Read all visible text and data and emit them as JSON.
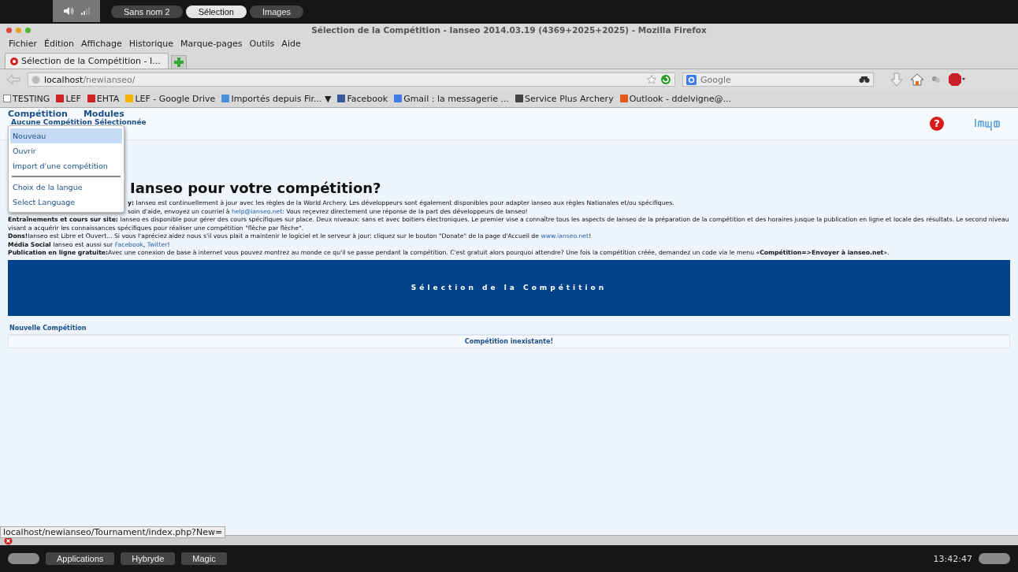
{
  "top_panel": {
    "tabs": [
      {
        "label": "Sans nom 2",
        "selected": false
      },
      {
        "label": "Sélection",
        "selected": true
      },
      {
        "label": "Images",
        "selected": false
      }
    ]
  },
  "window": {
    "title": "Sélection de la Compétition - Ianseo 2014.03.19 (4369+2025+2025) - Mozilla Firefox",
    "menu": [
      "Fichier",
      "Édition",
      "Affichage",
      "Historique",
      "Marque-pages",
      "Outils",
      "Aide"
    ],
    "tab_title": "Sélection de la Compétition - I...",
    "url": {
      "host": "localhost",
      "path": "/newianseo/"
    },
    "search": {
      "placeholder": "Google"
    },
    "bookmarks": [
      {
        "label": "TESTING",
        "kind": "blank"
      },
      {
        "label": "LEF",
        "kind": "ianseo"
      },
      {
        "label": "EHTA",
        "kind": "ianseo"
      },
      {
        "label": "LEF - Google Drive",
        "kind": "drive"
      },
      {
        "label": "Importés depuis Fir... ▼",
        "kind": "folder"
      },
      {
        "label": "Facebook",
        "kind": "facebook"
      },
      {
        "label": "Gmail : la messagerie ...",
        "kind": "google"
      },
      {
        "label": "Service Plus Archery",
        "kind": "service"
      },
      {
        "label": "Outlook - ddelvigne@...",
        "kind": "outlook"
      }
    ]
  },
  "page": {
    "nav": [
      "Compétition",
      "Modules"
    ],
    "subtitle": "Aucune Compétition Sélectionnée",
    "dropdown": [
      [
        {
          "label": "Nouveau",
          "selected": true
        },
        {
          "label": "Ouvrir",
          "selected": false
        },
        {
          "label": "Import d'une compétition",
          "selected": false
        }
      ],
      [
        {
          "label": "Choix de la langue",
          "selected": false
        },
        {
          "label": "Select Language",
          "selected": false
        }
      ]
    ],
    "help_icon": "?",
    "heading": "Ianseo pour votre compétition?",
    "paragraphs": [
      [
        {
          "kind": "bold",
          "text": "y:"
        },
        {
          "kind": "plain",
          "text": " Ianseo est continuellement à jour avec les règles de la World Archery. Les développeurs sont également disponibles pour adapter ianseo aux règles Nationales et/ou spécifiques."
        }
      ],
      [
        {
          "kind": "plain",
          "text": "soin d'aide, envoyez un courriel à "
        },
        {
          "kind": "link",
          "text": "help@ianseo.net"
        },
        {
          "kind": "plain",
          "text": ": Vous reçevrez directement une réponse de la part des développeurs de Ianseo!"
        }
      ],
      [
        {
          "kind": "bold",
          "text": "Entraînements et cours sur site:"
        },
        {
          "kind": "plain",
          "text": " Ianseo es disponible pour gérer des cours spécifiques sur place. Deux niveaux: sans et avec boitiers électroniques. Le premier vise a connaître tous les aspects de Ianseo de la préparation de la compétition et des horaires jusque la publication en ligne et locale des résultats. Le second niveau visant a acquérir les connaissances spécifiques pour réaliser une compétition \"flèche par flèche\"."
        }
      ],
      [
        {
          "kind": "bold",
          "text": "Dons!"
        },
        {
          "kind": "plain",
          "text": "Ianseo est Libre et Ouvert... Si vous l'apréciez aidez nous s'il vous plait a maintenir le logiciel et le serveur à jour: cliquez sur le bouton \"Donate\" de la page d'Accueil de "
        },
        {
          "kind": "link",
          "text": "www.ianseo.net"
        },
        {
          "kind": "plain",
          "text": "!"
        }
      ],
      [
        {
          "kind": "bold",
          "text": "Média Social"
        },
        {
          "kind": "plain",
          "text": " Ianseo est aussi sur "
        },
        {
          "kind": "link",
          "text": "Facebook"
        },
        {
          "kind": "plain",
          "text": ", "
        },
        {
          "kind": "link",
          "text": "Twitter"
        },
        {
          "kind": "plain",
          "text": "!"
        }
      ],
      [
        {
          "kind": "bold",
          "text": "Publication en ligne gratuite:"
        },
        {
          "kind": "plain",
          "text": "Avec une conexion de base à internet vous pouvez montrez au monde ce qu'il se passe pendant la compétition. C'est gratuit alors pourquoi attendre? Une fois la compétition créée, demandez un code via le menu «"
        },
        {
          "kind": "bold",
          "text": "Compétition=>Envoyer à ianseo.net"
        },
        {
          "kind": "plain",
          "text": "»."
        }
      ]
    ],
    "banner": "Sélection de la Compétition",
    "table": {
      "header": "Nouvelle Compétition",
      "rows": [
        "Compétition inexistante!"
      ]
    }
  },
  "status_url": "localhost/newianseo/Tournament/index.php?New=",
  "taskbar": {
    "items": [
      "Applications",
      "Hybryde",
      "Magic"
    ],
    "clock": "13:42:47"
  }
}
